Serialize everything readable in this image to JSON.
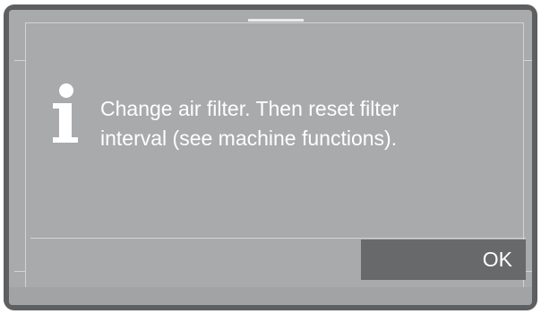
{
  "dialog": {
    "message": "Change air filter. Then reset filter\ninterval (see machine functions).",
    "icon": "info-icon",
    "ok_label": "OK"
  },
  "colors": {
    "bezel": "#5e5f61",
    "screen": "#a9aaac",
    "button": "#68696b",
    "text": "#ffffff"
  }
}
